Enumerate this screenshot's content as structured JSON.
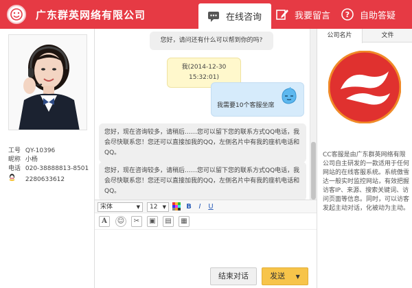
{
  "header": {
    "company": "广东群英网络有限公司",
    "tabs": [
      {
        "label": "在线咨询",
        "icon": "chat-icon",
        "active": true
      },
      {
        "label": "我要留言",
        "icon": "edit-icon",
        "active": false
      },
      {
        "label": "自助答疑",
        "icon": "help-icon",
        "active": false
      }
    ]
  },
  "agent": {
    "id_label": "工号",
    "id": "QY-10396",
    "nick_label": "昵称",
    "nick": "小杨",
    "phone_label": "电话",
    "phone": "020-38888813-8501",
    "qq": "2280633612"
  },
  "chat": {
    "sys_msg": "您好，请问还有什么可以帮到你的吗?",
    "me_msg": "我(2014-12-30 15:32:01)",
    "customer_msg": "我需要10个客服坐席",
    "agent_msg1": "您好，现在咨询较多，请稍后……您可以留下您的联系方式QQ电话，我会尽快联系您！您还可以直接加我的QQ，左侧名片中有我的座机电话和QQ。",
    "agent_msg2": "您好，现在咨询较多，请稍后……您可以留下您的联系方式QQ电话，我会尽快联系您！您还可以直接加我的QQ，左侧名片中有我的座机电话和QQ。"
  },
  "toolbar": {
    "font": "宋体",
    "size": "12",
    "bold": "B",
    "italic": "I",
    "underline": "U"
  },
  "buttons": {
    "end": "结束对话",
    "send": "发送"
  },
  "right": {
    "tab1": "公司名片",
    "tab2": "文件",
    "description": "CC客服是由广东群英网络有限公司自主研发的一款适用于任何网站的在线客服系统。系统傲雪达一般实时监控网站，有效把握访客IP、来源、搜索关键词、访问页面等信息。同时，可以访客发起主动对话，化被动为主动。"
  },
  "colors": {
    "brand": "#e63a44",
    "send": "#f7c44a"
  }
}
